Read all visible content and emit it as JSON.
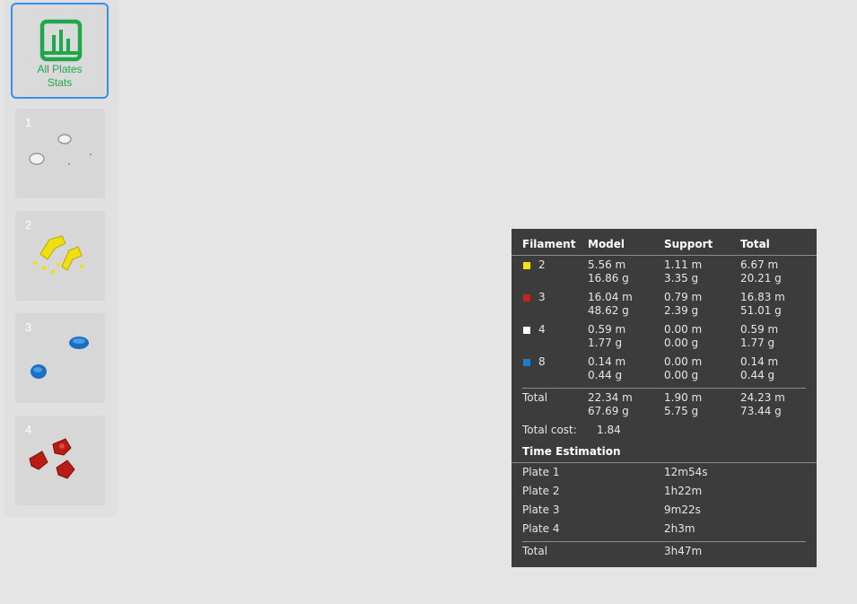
{
  "sidebar": {
    "all_plates_label": "All Plates Stats",
    "plates": [
      {
        "number": "1",
        "model_color": "#d8d8d8"
      },
      {
        "number": "2",
        "model_color": "#f0e010"
      },
      {
        "number": "3",
        "model_color": "#1a6fc4"
      },
      {
        "number": "4",
        "model_color": "#b81c14"
      }
    ]
  },
  "stats": {
    "headers": {
      "filament": "Filament",
      "model": "Model",
      "support": "Support",
      "total": "Total"
    },
    "filaments": [
      {
        "id": "2",
        "color": "#f5e400",
        "model_m": "5.56 m",
        "model_g": "16.86 g",
        "support_m": "1.11 m",
        "support_g": "3.35 g",
        "total_m": "6.67 m",
        "total_g": "20.21 g"
      },
      {
        "id": "3",
        "color": "#c8221a",
        "model_m": "16.04 m",
        "model_g": "48.62 g",
        "support_m": "0.79 m",
        "support_g": "2.39 g",
        "total_m": "16.83 m",
        "total_g": "51.01 g"
      },
      {
        "id": "4",
        "color": "#ffffff",
        "model_m": "0.59 m",
        "model_g": "1.77 g",
        "support_m": "0.00 m",
        "support_g": "0.00 g",
        "total_m": "0.59 m",
        "total_g": "1.77 g"
      },
      {
        "id": "8",
        "color": "#1a7fd0",
        "model_m": "0.14 m",
        "model_g": "0.44 g",
        "support_m": "0.00 m",
        "support_g": "0.00 g",
        "total_m": "0.14 m",
        "total_g": "0.44 g"
      }
    ],
    "total_row": {
      "label": "Total",
      "model_m": "22.34 m",
      "model_g": "67.69 g",
      "support_m": "1.90 m",
      "support_g": "5.75 g",
      "total_m": "24.23 m",
      "total_g": "73.44 g"
    },
    "total_cost_label": "Total cost:",
    "total_cost_value": "1.84",
    "time_header": "Time Estimation",
    "times": [
      {
        "plate": "Plate 1",
        "time": "12m54s"
      },
      {
        "plate": "Plate 2",
        "time": "1h22m"
      },
      {
        "plate": "Plate 3",
        "time": "9m22s"
      },
      {
        "plate": "Plate 4",
        "time": "2h3m"
      }
    ],
    "time_total": {
      "label": "Total",
      "time": "3h47m"
    }
  }
}
